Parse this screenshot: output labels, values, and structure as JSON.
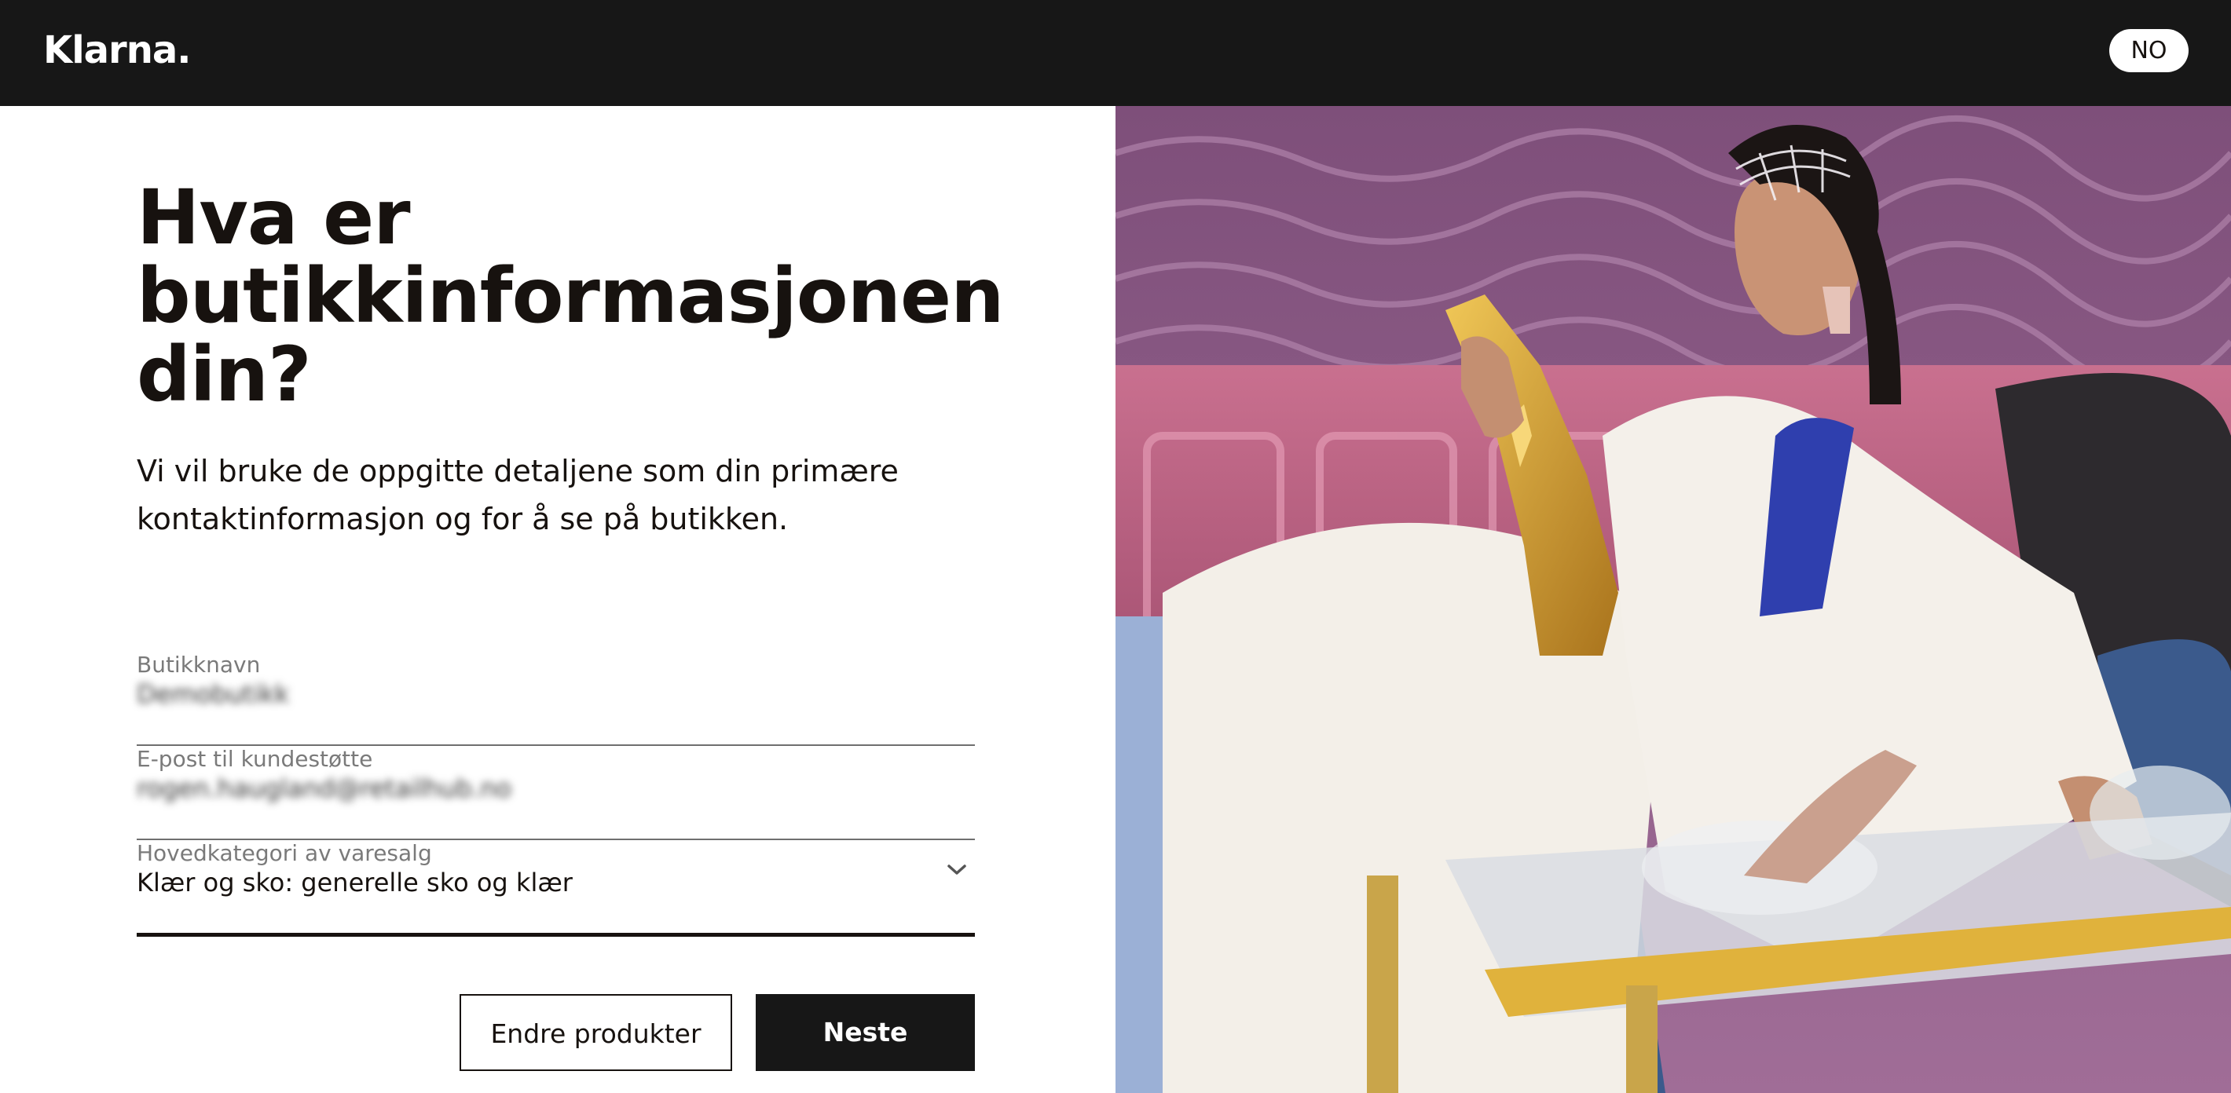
{
  "header": {
    "logo": "Klarna.",
    "language_button": "NO"
  },
  "main": {
    "heading": "Hva er butikkinformasjonen din?",
    "subtitle": "Vi vil bruke de oppgitte detaljene som din primære kontaktinformasjon og for å se på butikken."
  },
  "form": {
    "store_name": {
      "label": "Butikknavn",
      "value": "Demobutikk"
    },
    "support_email": {
      "label": "E-post til kundestøtte",
      "value": "rogen.haugland@retailhub.no"
    },
    "category": {
      "label": "Hovedkategori av varesalg",
      "value": "Klær og sko: generelle sko og klær"
    }
  },
  "buttons": {
    "edit_products": "Endre produkter",
    "next": "Neste"
  },
  "hero_image": {
    "icon": "fashion-photo",
    "colors": {
      "wall": "#8a5a86",
      "wainscot": "#c46f8f",
      "suit": "#f3efe8",
      "gold": "#d6a234",
      "chair": "#3a5a8a"
    }
  }
}
